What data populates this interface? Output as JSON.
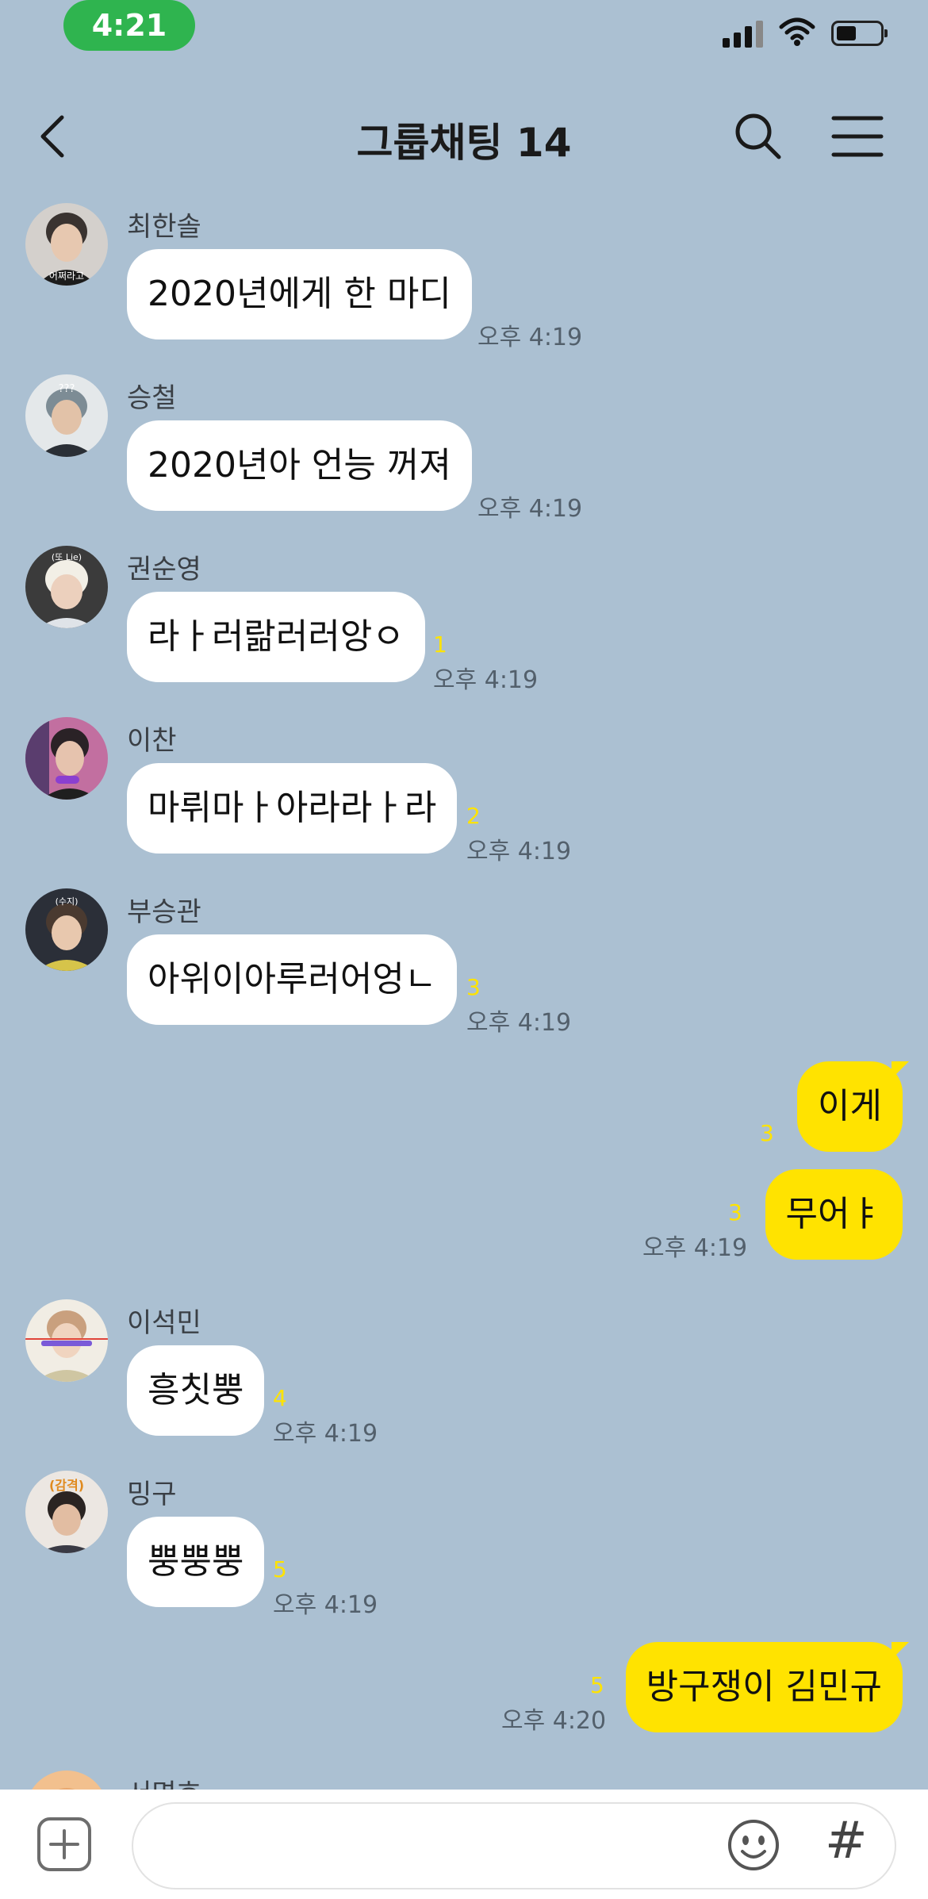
{
  "status_bar": {
    "time": "4:21",
    "battery_level": 0.4,
    "signal_bars": 3,
    "icons": [
      "signal-icon",
      "wifi-icon",
      "battery-icon"
    ]
  },
  "header": {
    "title": "그룹채팅 14",
    "icons": [
      "back-arrow-icon",
      "search-icon",
      "menu-icon"
    ]
  },
  "messages": [
    {
      "sender": "최한솔",
      "text": "2020년에게 한 마디",
      "time": "오후 4:19",
      "unread": ""
    },
    {
      "sender": "승철",
      "text": "2020년아 언능 꺼져",
      "time": "오후 4:19",
      "unread": ""
    },
    {
      "sender": "권순영",
      "text": "라ㅏ러랆러러앙ㅇ",
      "time": "오후 4:19",
      "unread": "1"
    },
    {
      "sender": "이찬",
      "text": "마뤼마ㅏ아라라ㅏ라",
      "time": "오후 4:19",
      "unread": "2"
    },
    {
      "sender": "부승관",
      "text": "아위이아루러어엉ㄴ",
      "time": "오후 4:19",
      "unread": "3"
    },
    {
      "sender": "me",
      "text": "이게",
      "time": "",
      "unread": "3"
    },
    {
      "sender": "me",
      "text": "무어ㅑ",
      "time": "오후 4:19",
      "unread": "3"
    },
    {
      "sender": "이석민",
      "text": "흥칫뿡",
      "time": "오후 4:19",
      "unread": "4"
    },
    {
      "sender": "밍구",
      "text": "뿡뿡뿡",
      "time": "오후 4:19",
      "unread": "5"
    },
    {
      "sender": "me",
      "text": "방구쟁이 김민규",
      "time": "오후 4:20",
      "unread": "5"
    },
    {
      "sender": "서명호",
      "text": "",
      "time": "",
      "unread": ""
    }
  ],
  "avatars": {
    "hansol": "어쩌라고",
    "seungcheol": "???",
    "soonyoung": "(또 Lie)",
    "seungkwan": "(수지)",
    "mingu": "(감격)"
  },
  "input": {
    "value": "",
    "placeholder": ""
  },
  "colors": {
    "background": "#abc0d2",
    "my_bubble": "#ffe300",
    "their_bubble": "#ffffff",
    "status_pill": "#2fb44f",
    "unread": "#ffe300"
  }
}
